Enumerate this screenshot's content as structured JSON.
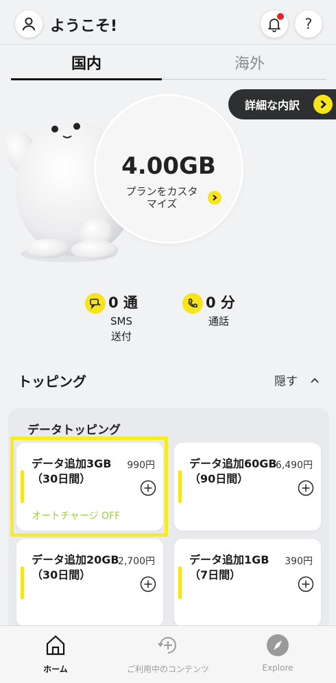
{
  "header": {
    "welcome": "ようこそ!",
    "help_symbol": "?"
  },
  "tabs": [
    {
      "label": "国内",
      "active": true
    },
    {
      "label": "海外",
      "active": false
    }
  ],
  "detail_button": "詳細な内訳",
  "plan": {
    "data_amount": "4.00GB",
    "customize_label": "プランをカスタマイズ"
  },
  "usage": {
    "sms": {
      "value": "0 通",
      "label_line1": "SMS",
      "label_line2": "送付"
    },
    "call": {
      "value": "0 分",
      "label": "通話"
    }
  },
  "topping": {
    "title": "トッピング",
    "hide_label": "隠す",
    "panel_title": "データトッピング",
    "cards": [
      {
        "title": "データ追加3GB（30日間）",
        "price": "990円",
        "auto_charge": "オートチャージ OFF"
      },
      {
        "title": "データ追加60GB（90日間）",
        "price": "6,490円"
      },
      {
        "title": "データ追加20GB（30日間）",
        "price": "2,700円"
      },
      {
        "title": "データ追加1GB（7日間）",
        "price": "390円"
      }
    ]
  },
  "bottom_nav": [
    {
      "label": "ホーム",
      "icon": "home-icon",
      "active": true
    },
    {
      "label": "ご利用中のコンテンツ",
      "icon": "content-add-icon",
      "active": false
    },
    {
      "label": "Explore",
      "icon": "compass-icon",
      "active": false
    }
  ],
  "colors": {
    "accent_yellow": "#f6e41c",
    "highlight_yellow": "#f8ec1e",
    "auto_charge_green": "#9ccc3c",
    "notification_red": "#e8231f"
  }
}
